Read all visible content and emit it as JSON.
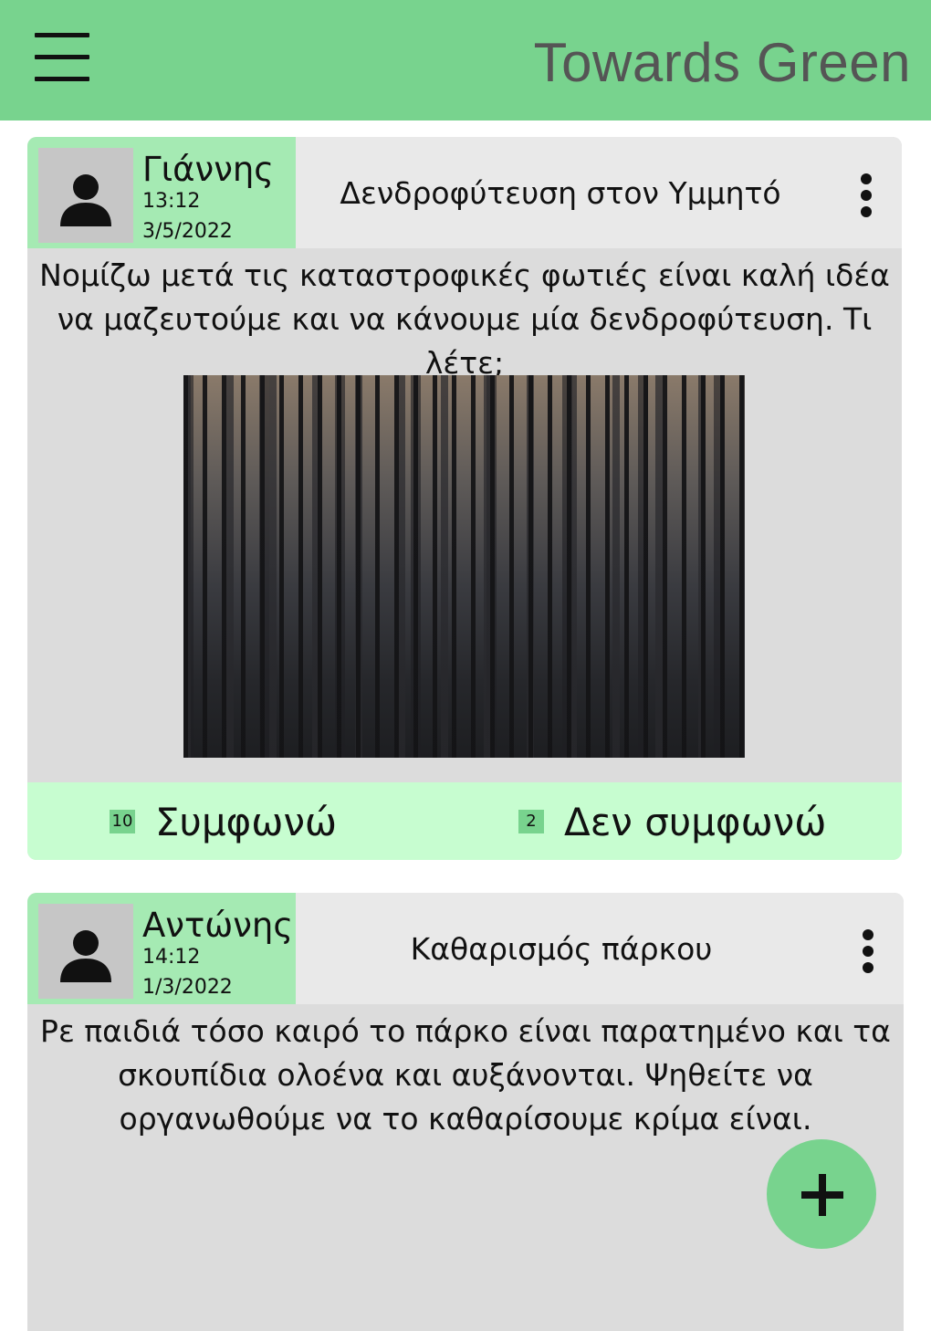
{
  "app": {
    "title": "Towards Green"
  },
  "icons": {
    "menu": "hamburger-menu-icon",
    "avatar": "person-icon",
    "more": "more-vertical-icon",
    "add": "plus-icon"
  },
  "colors": {
    "appbar": "#78d38e",
    "author_bg": "#a5eab3",
    "vote_bar": "#c7fdd0",
    "card_bg": "#dcdcdc",
    "count_badge": "#78d38e"
  },
  "posts": [
    {
      "author": "Γιάννης",
      "time": "13:12",
      "date": "3/5/2022",
      "title": "Δενδροφύτευση στον Υμμητό",
      "body": "Νομίζω μετά τις καταστροφικές φωτιές είναι καλή ιδέα να μαζευτούμε και να κάνουμε μία δενδροφύτευση. Τι λέτε;",
      "image": "burnt-forest-photo",
      "agree_count": "10",
      "agree_label": "Συμφωνώ",
      "disagree_count": "2",
      "disagree_label": "Δεν συμφωνώ"
    },
    {
      "author": "Αντώνης",
      "time": "14:12",
      "date": "1/3/2022",
      "title": "Καθαρισμός πάρκου",
      "body": "Ρε παιδιά τόσο καιρό το πάρκο είναι παρατημένο και τα σκουπίδια ολοένα και αυξάνονται. Ψηθείτε να οργανωθούμε να το καθαρίσουμε κρίμα είναι."
    }
  ]
}
